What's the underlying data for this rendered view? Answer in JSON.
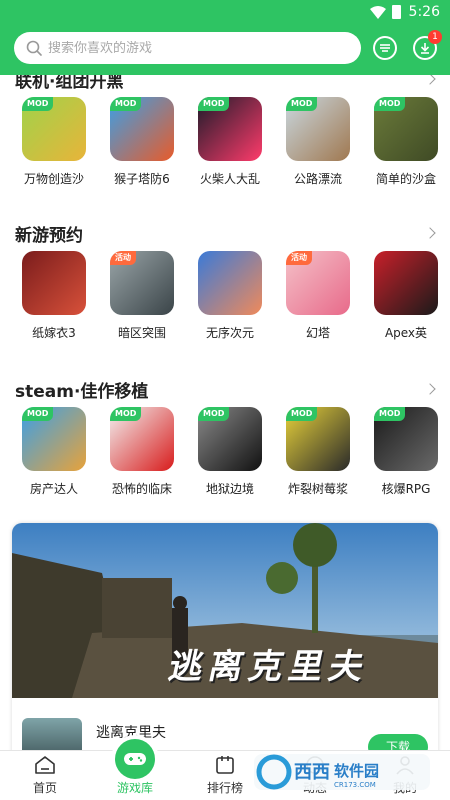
{
  "status_bar": {
    "time": "5:26"
  },
  "search": {
    "placeholder": "搜索你喜欢的游戏"
  },
  "header": {
    "download_badge": "1"
  },
  "sections": [
    {
      "title": "联机·组团开黑",
      "games": [
        {
          "name": "万物创造沙",
          "tag": "MOD",
          "colors": [
            "#9fd34a",
            "#e8b43a"
          ]
        },
        {
          "name": "猴子塔防6",
          "tag": "MOD",
          "colors": [
            "#3aa0e8",
            "#e85b2a"
          ]
        },
        {
          "name": "火柴人大乱",
          "tag": "MOD",
          "colors": [
            "#1b1b2a",
            "#ff3b6b"
          ]
        },
        {
          "name": "公路漂流",
          "tag": "MOD",
          "colors": [
            "#c9d8e0",
            "#a07850"
          ]
        },
        {
          "name": "简单的沙盒",
          "tag": "MOD",
          "colors": [
            "#6b7b3a",
            "#3f4a25"
          ]
        }
      ]
    },
    {
      "title": "新游预约",
      "games": [
        {
          "name": "纸嫁衣3",
          "tag": "",
          "colors": [
            "#7a1c1c",
            "#d8513a"
          ]
        },
        {
          "name": "暗区突围",
          "tag": "活动",
          "colors": [
            "#9aa5a8",
            "#3a4448"
          ]
        },
        {
          "name": "无序次元",
          "tag": "",
          "colors": [
            "#3a7ad8",
            "#f08a5a"
          ]
        },
        {
          "name": "幻塔",
          "tag": "活动",
          "colors": [
            "#f4c1c8",
            "#e86a8a"
          ]
        },
        {
          "name": "Apex英",
          "tag": "",
          "colors": [
            "#c8202a",
            "#1a1a1a"
          ]
        }
      ]
    },
    {
      "title": "steam·佳作移植",
      "games": [
        {
          "name": "房产达人",
          "tag": "MOD",
          "colors": [
            "#3aa0e8",
            "#e8a23a"
          ]
        },
        {
          "name": "恐怖的临床",
          "tag": "MOD",
          "colors": [
            "#f2f2f2",
            "#d81c1c"
          ]
        },
        {
          "name": "地狱边境",
          "tag": "MOD",
          "colors": [
            "#8a8a8a",
            "#111111"
          ]
        },
        {
          "name": "炸裂树莓浆",
          "tag": "MOD",
          "colors": [
            "#e8d23a",
            "#2a2a2a"
          ]
        },
        {
          "name": "核爆RPG",
          "tag": "MOD",
          "colors": [
            "#1a1a1a",
            "#6a6a6a"
          ]
        }
      ]
    }
  ],
  "banner": {
    "overlay_text": "逃离克里夫",
    "game_name": "逃离克里夫",
    "download_label": "下载"
  },
  "bottom_nav": [
    {
      "label": "首页",
      "icon": "home-icon",
      "active": false
    },
    {
      "label": "游戏库",
      "icon": "gamepad-icon",
      "active": true
    },
    {
      "label": "排行榜",
      "icon": "rank-icon",
      "active": false
    },
    {
      "label": "动态",
      "icon": "feed-icon",
      "active": false
    },
    {
      "label": "我的",
      "icon": "profile-icon",
      "active": false
    }
  ],
  "watermark": {
    "text": "西西软件园",
    "sub": "CR173.COM"
  },
  "colors": {
    "brand": "#2ec463",
    "badge": "#ff3b30",
    "activity_tag": "#ff6a3d"
  }
}
